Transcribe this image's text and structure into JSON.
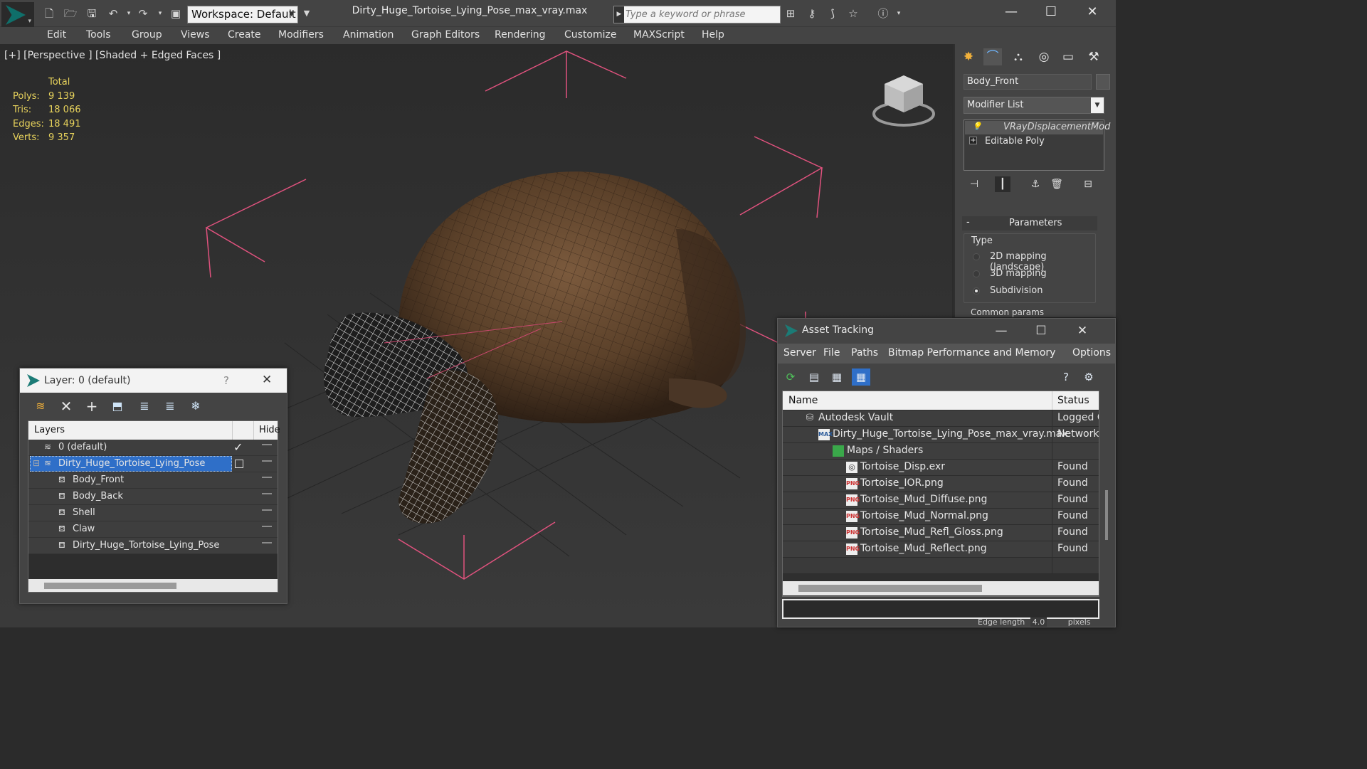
{
  "titlebar": {
    "file_title": "Dirty_Huge_Tortoise_Lying_Pose_max_vray.max",
    "workspace_label": "Workspace: Default",
    "search_placeholder": "Type a keyword or phrase"
  },
  "menu": [
    "Edit",
    "Tools",
    "Group",
    "Views",
    "Create",
    "Modifiers",
    "Animation",
    "Graph Editors",
    "Rendering",
    "Customize",
    "MAXScript",
    "Help"
  ],
  "viewport": {
    "label": "[+] [Perspective ] [Shaded + Edged Faces ]",
    "stats": {
      "header": "Total",
      "rows": [
        {
          "label": "Polys:",
          "value": "9 139"
        },
        {
          "label": "Tris:",
          "value": "18 066"
        },
        {
          "label": "Edges:",
          "value": "18 491"
        },
        {
          "label": "Verts:",
          "value": "9 357"
        }
      ]
    },
    "edge_length_label": "Edge length",
    "edge_length_value": "4.0",
    "units_label": "pixels"
  },
  "command_panel": {
    "object_name": "Body_Front",
    "modifier_list": "Modifier List",
    "stack": [
      "VRayDisplacementMod",
      "Editable Poly"
    ],
    "params_title": "Parameters",
    "type_label": "Type",
    "options": [
      {
        "label": "2D mapping (landscape)",
        "selected": false
      },
      {
        "label": "3D mapping",
        "selected": false
      },
      {
        "label": "Subdivision",
        "selected": true
      }
    ],
    "common_params": "Common params"
  },
  "layer_dialog": {
    "title": "Layer: 0 (default)",
    "help": "?",
    "col_layers": "Layers",
    "col_hide": "Hide",
    "rows": [
      {
        "name": "0 (default)",
        "indent": 0,
        "selected": false,
        "check": true
      },
      {
        "name": "Dirty_Huge_Tortoise_Lying_Pose",
        "indent": 0,
        "selected": true,
        "check": false
      },
      {
        "name": "Body_Front",
        "indent": 1,
        "selected": false,
        "check": false
      },
      {
        "name": "Body_Back",
        "indent": 1,
        "selected": false,
        "check": false
      },
      {
        "name": "Shell",
        "indent": 1,
        "selected": false,
        "check": false
      },
      {
        "name": "Claw",
        "indent": 1,
        "selected": false,
        "check": false
      },
      {
        "name": "Dirty_Huge_Tortoise_Lying_Pose",
        "indent": 1,
        "selected": false,
        "check": false
      }
    ]
  },
  "asset_dialog": {
    "title": "Asset Tracking",
    "menu": [
      "Server",
      "File",
      "Paths",
      "Bitmap Performance and Memory",
      "Options"
    ],
    "col_name": "Name",
    "col_status": "Status",
    "rows": [
      {
        "name": "Autodesk Vault",
        "status": "Logged C",
        "level": 0,
        "icon": "vault-icon"
      },
      {
        "name": "Dirty_Huge_Tortoise_Lying_Pose_max_vray.max",
        "status": "Network",
        "level": 1,
        "icon": "max-file-icon"
      },
      {
        "name": "Maps / Shaders",
        "status": "",
        "level": 2,
        "icon": "maps-icon"
      },
      {
        "name": "Tortoise_Disp.exr",
        "status": "Found",
        "level": 3,
        "icon": "exr-icon"
      },
      {
        "name": "Tortoise_IOR.png",
        "status": "Found",
        "level": 3,
        "icon": "png-icon"
      },
      {
        "name": "Tortoise_Mud_Diffuse.png",
        "status": "Found",
        "level": 3,
        "icon": "png-icon"
      },
      {
        "name": "Tortoise_Mud_Normal.png",
        "status": "Found",
        "level": 3,
        "icon": "png-icon"
      },
      {
        "name": "Tortoise_Mud_Refl_Gloss.png",
        "status": "Found",
        "level": 3,
        "icon": "png-icon"
      },
      {
        "name": "Tortoise_Mud_Reflect.png",
        "status": "Found",
        "level": 3,
        "icon": "png-icon"
      }
    ]
  },
  "colors": {
    "stats": "#e8d35c",
    "selection": "#2f6fc8",
    "bounding_box": "#e0527e",
    "app_teal": "#0f6f6a"
  }
}
